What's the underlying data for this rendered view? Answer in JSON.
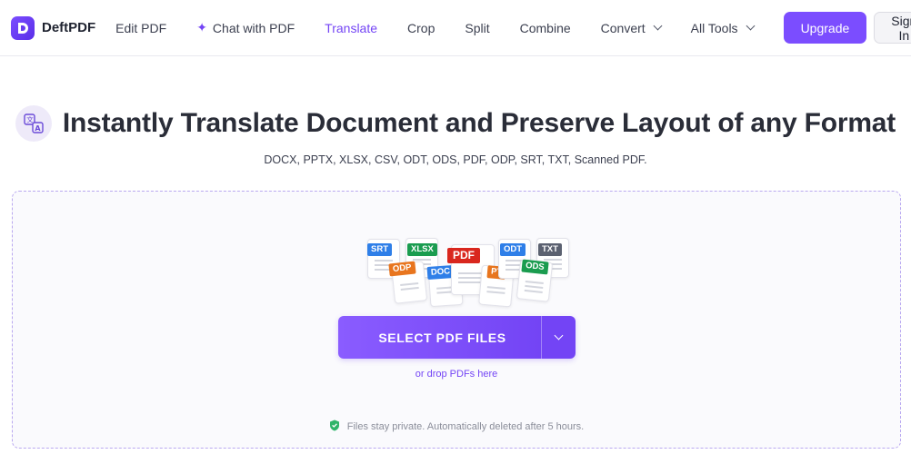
{
  "header": {
    "logo_text": "DeftPDF",
    "nav": [
      {
        "label": "Edit PDF"
      },
      {
        "label": "Chat with PDF"
      },
      {
        "label": "Translate"
      },
      {
        "label": "Crop"
      },
      {
        "label": "Split"
      },
      {
        "label": "Combine"
      },
      {
        "label": "Convert"
      },
      {
        "label": "All Tools"
      }
    ],
    "upgrade_label": "Upgrade",
    "signin_label": "Sign In"
  },
  "hero": {
    "title": "Instantly Translate Document and Preserve Layout of any Format",
    "formats": "DOCX, PPTX, XLSX, CSV, ODT, ODS, PDF, ODP, SRT, TXT, Scanned PDF."
  },
  "dropzone": {
    "file_tags": [
      "SRT",
      "XLSX",
      "PDF",
      "ODT",
      "TXT",
      "ODP",
      "DOC",
      "PT",
      "ODS"
    ],
    "select_label": "SELECT PDF FILES",
    "drop_hint": "or drop PDFs here",
    "privacy_text": "Files stay private. Automatically deleted after 5 hours."
  },
  "colors": {
    "accent": "#7b4dff",
    "active_nav": "#7445f5",
    "privacy_shield": "#2fb46a"
  }
}
